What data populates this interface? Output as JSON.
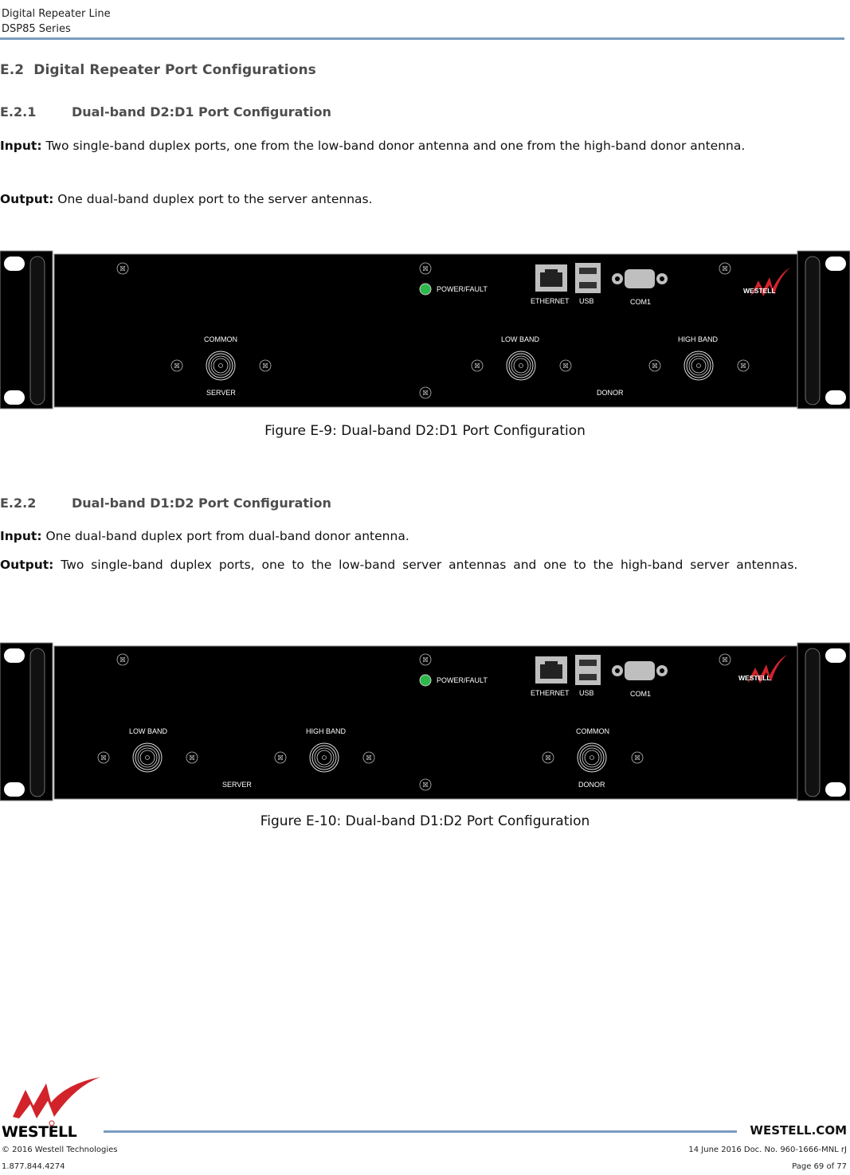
{
  "header": {
    "line1": "Digital Repeater Line",
    "line2": "DSP85 Series"
  },
  "section": {
    "number": "E.2",
    "title": "Digital Repeater Port Configurations"
  },
  "subsections": [
    {
      "number": "E.2.1",
      "title": "Dual-band D2:D1 Port Configuration",
      "input_label": "Input:",
      "input_text": " Two single-band duplex ports, one from the low-band donor antenna and one from the high-band donor antenna.",
      "output_label": "Output:",
      "output_text": " One dual-band duplex port to the server antennas.",
      "figure": {
        "caption": "Figure E-9: Dual-band D2:D1 Port Configuration",
        "labels": {
          "power": "POWER/FAULT",
          "ethernet": "ETHERNET",
          "usb": "USB",
          "com": "COM1",
          "brand": "WESTELL",
          "port_a": "COMMON",
          "group_a": "SERVER",
          "port_b": "LOW BAND",
          "port_c": "HIGH BAND",
          "group_b": "DONOR"
        },
        "led_color": "#2db84a"
      }
    },
    {
      "number": "E.2.2",
      "title": "Dual-band D1:D2 Port Configuration",
      "input_label": "Input:",
      "input_text": " One dual-band duplex port from dual-band donor antenna.",
      "output_label": "Output:",
      "output_text": " Two single-band duplex ports, one to the low-band server antennas and one to the high-band server antennas.",
      "figure": {
        "caption": "Figure E-10: Dual-band D1:D2 Port Configuration",
        "labels": {
          "power": "POWER/FAULT",
          "ethernet": "ETHERNET",
          "usb": "USB",
          "com": "COM1",
          "brand": "WESTELL",
          "port_a": "LOW BAND",
          "port_b": "HIGH BAND",
          "group_a": "SERVER",
          "port_c": "COMMON",
          "group_b": "DONOR"
        },
        "led_color": "#2db84a"
      }
    }
  ],
  "footer": {
    "brand": "WESTELL",
    "website": "WESTELL.COM",
    "copyright": "© 2016 Westell Technologies",
    "phone": "1.877.844.4274",
    "doc": "14 June 2016 Doc. No. 960-1666-MNL rJ",
    "page": "Page 69 of 77",
    "brand_color": "#d2232a",
    "rule_color": "#7a9cc0"
  }
}
